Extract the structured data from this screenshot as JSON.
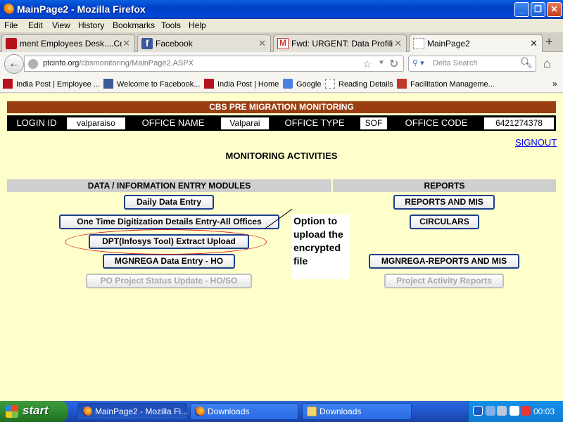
{
  "window": {
    "title": "MainPage2 - Mozilla Firefox"
  },
  "menu": [
    "File",
    "Edit",
    "View",
    "History",
    "Bookmarks",
    "Tools",
    "Help"
  ],
  "tabs": [
    {
      "label": "ment Employees Desk....Cen...",
      "icon": "india-post-icon"
    },
    {
      "label": "Facebook",
      "icon": "facebook-icon"
    },
    {
      "label": "Fwd: URGENT: Data Profiling ...",
      "icon": "gmail-icon"
    },
    {
      "label": "MainPage2",
      "icon": "blank-page-icon"
    }
  ],
  "nav": {
    "url_host": "ptcinfo.org",
    "url_path": "/cbsmonitoring/MainPage2.ASPX",
    "search_placeholder": "Delta Search"
  },
  "bookmarks": [
    {
      "label": "India Post | Employee ...",
      "icon": "india-post-icon"
    },
    {
      "label": "Welcome to Facebook...",
      "icon": "facebook-icon"
    },
    {
      "label": "India Post | Home",
      "icon": "india-post-icon"
    },
    {
      "label": "Google",
      "icon": "google-icon"
    },
    {
      "label": "Reading Details",
      "icon": "blank-page-icon"
    },
    {
      "label": "Facilitation Manageme...",
      "icon": "facilitation-icon"
    }
  ],
  "page": {
    "banner": "CBS PRE MIGRATION MONITORING",
    "info": {
      "login_label": "LOGIN ID",
      "login_value": "valparaiso",
      "office_name_label": "OFFICE NAME",
      "office_name_value": "Valparai",
      "office_type_label": "OFFICE TYPE",
      "office_type_value": "SOF",
      "office_code_label": "OFFICE CODE",
      "office_code_value": "6421274378"
    },
    "signout": "SIGNOUT",
    "monitoring_title": "MONITORING ACTIVITIES",
    "left_header": "DATA / INFORMATION ENTRY MODULES",
    "right_header": "REPORTS",
    "left_buttons": [
      "Daily Data Entry",
      "One Time Digitization Details Entry-All Offices",
      "DPT(Infosys Tool) Extract Upload",
      "MGNREGA Data Entry - HO",
      "PO Project Status Update - HO/SO"
    ],
    "right_buttons": [
      "REPORTS AND MIS",
      "CIRCULARS",
      "MGNREGA-REPORTS AND MIS",
      "Project Activity Reports"
    ],
    "callout": "Option to upload the encrypted file"
  },
  "taskbar": {
    "start": "start",
    "tasks": [
      "MainPage2 - Mozilla Fi...",
      "Downloads",
      "Downloads"
    ],
    "clock": "00:03"
  }
}
